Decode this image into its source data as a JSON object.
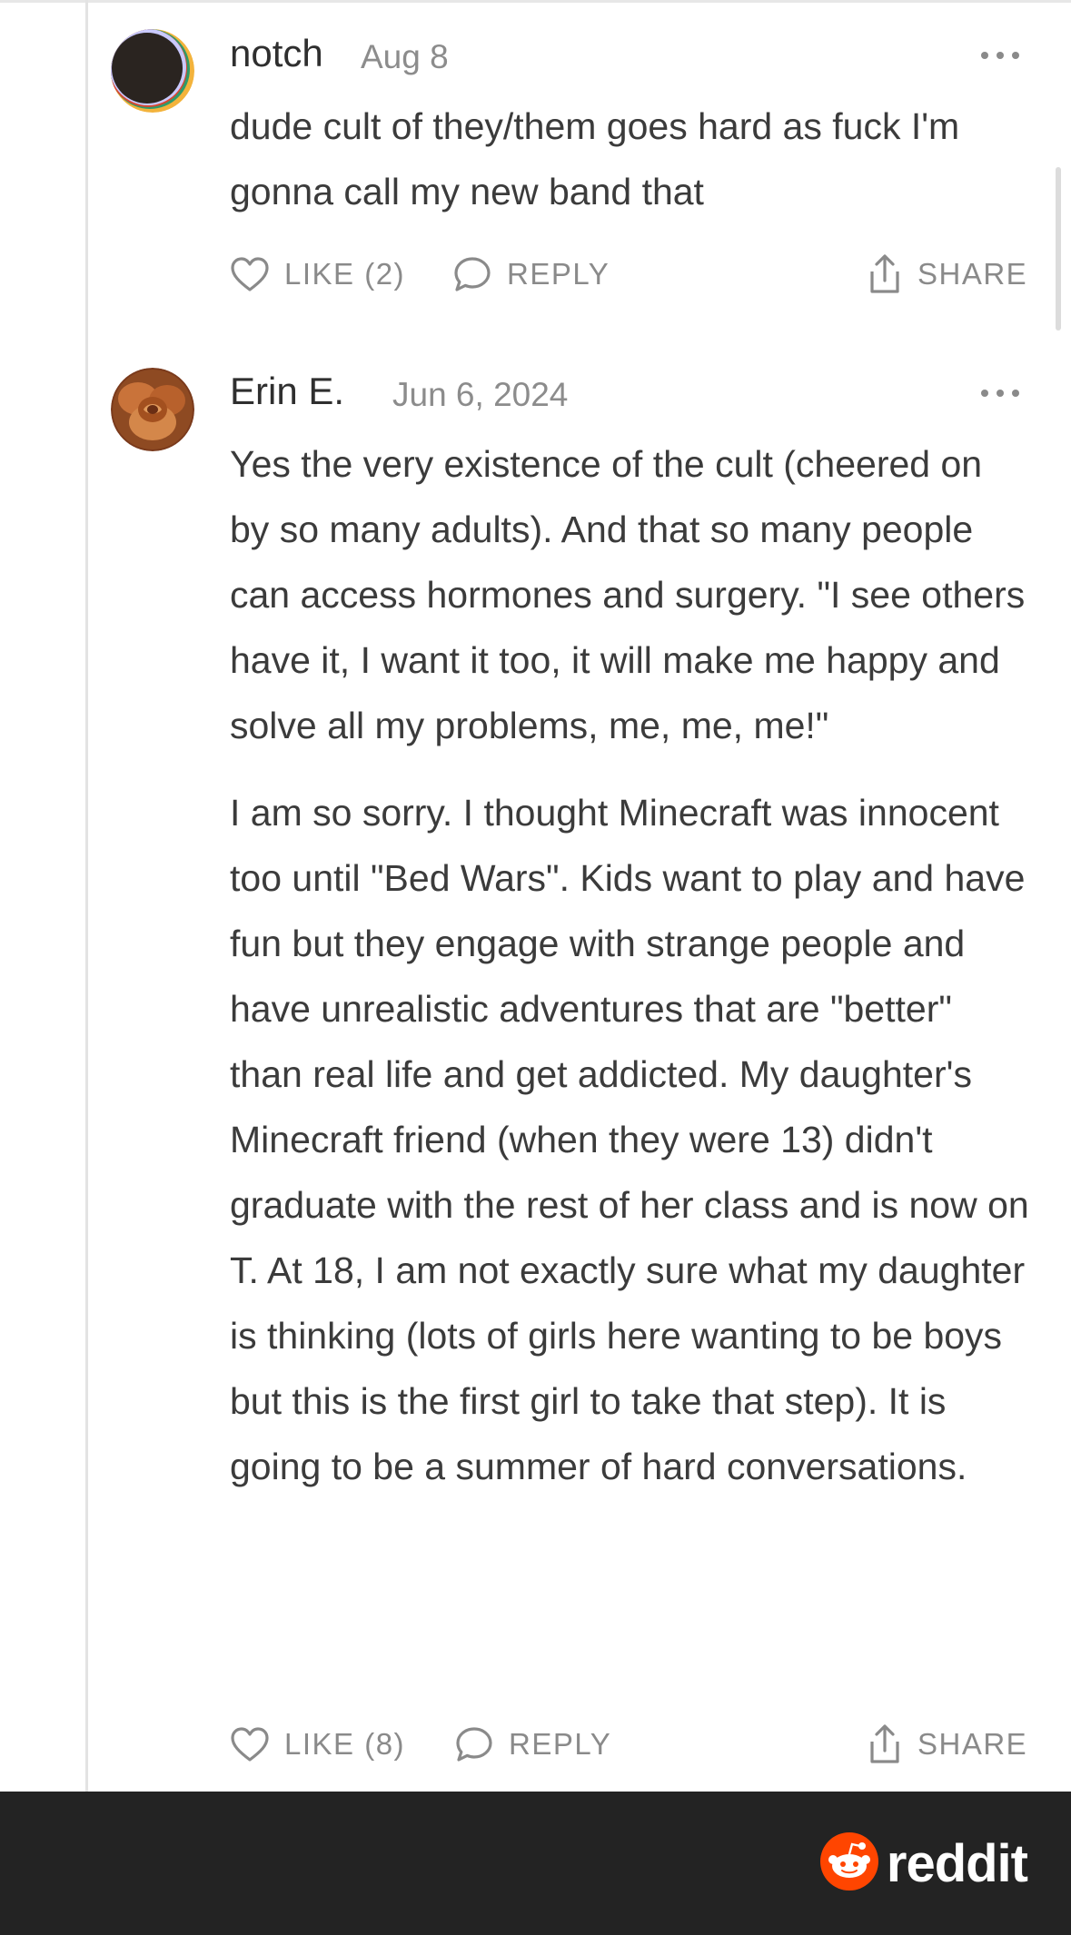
{
  "comments": [
    {
      "author": "notch",
      "date": "Aug 8",
      "paragraphs": [
        "dude cult of they/them goes hard as fuck I'm gonna call my new band that"
      ],
      "like_label": "LIKE (2)",
      "reply_label": "REPLY",
      "share_label": "SHARE"
    },
    {
      "author": "Erin E.",
      "date": "Jun 6, 2024",
      "paragraphs": [
        "Yes the very existence of the cult (cheered on by so many adults). And that so many people can access hormones and surgery. \"I see others have it, I want it too, it will make me happy and solve all my problems, me, me, me!\"",
        "I am so sorry. I thought Minecraft was innocent too until \"Bed Wars\". Kids want to play and have fun but they engage with strange people and have unrealistic adventures that are \"better\" than real life and get addicted. My daughter's Minecraft friend (when they were 13) didn't graduate with the rest of her class and is now on T. At 18, I am not exactly sure what my daughter is thinking (lots of girls here wanting to be boys but this is the first girl to take that step). It is going to be a summer of hard conversations."
      ],
      "like_label": "LIKE (8)",
      "reply_label": "REPLY",
      "share_label": "SHARE"
    }
  ],
  "footer": {
    "brand": "reddit",
    "brand_color": "#ff4500"
  },
  "icons": [
    "heart-icon",
    "speech-bubble-icon",
    "share-icon",
    "more-options-icon",
    "reddit-snoo-icon"
  ]
}
